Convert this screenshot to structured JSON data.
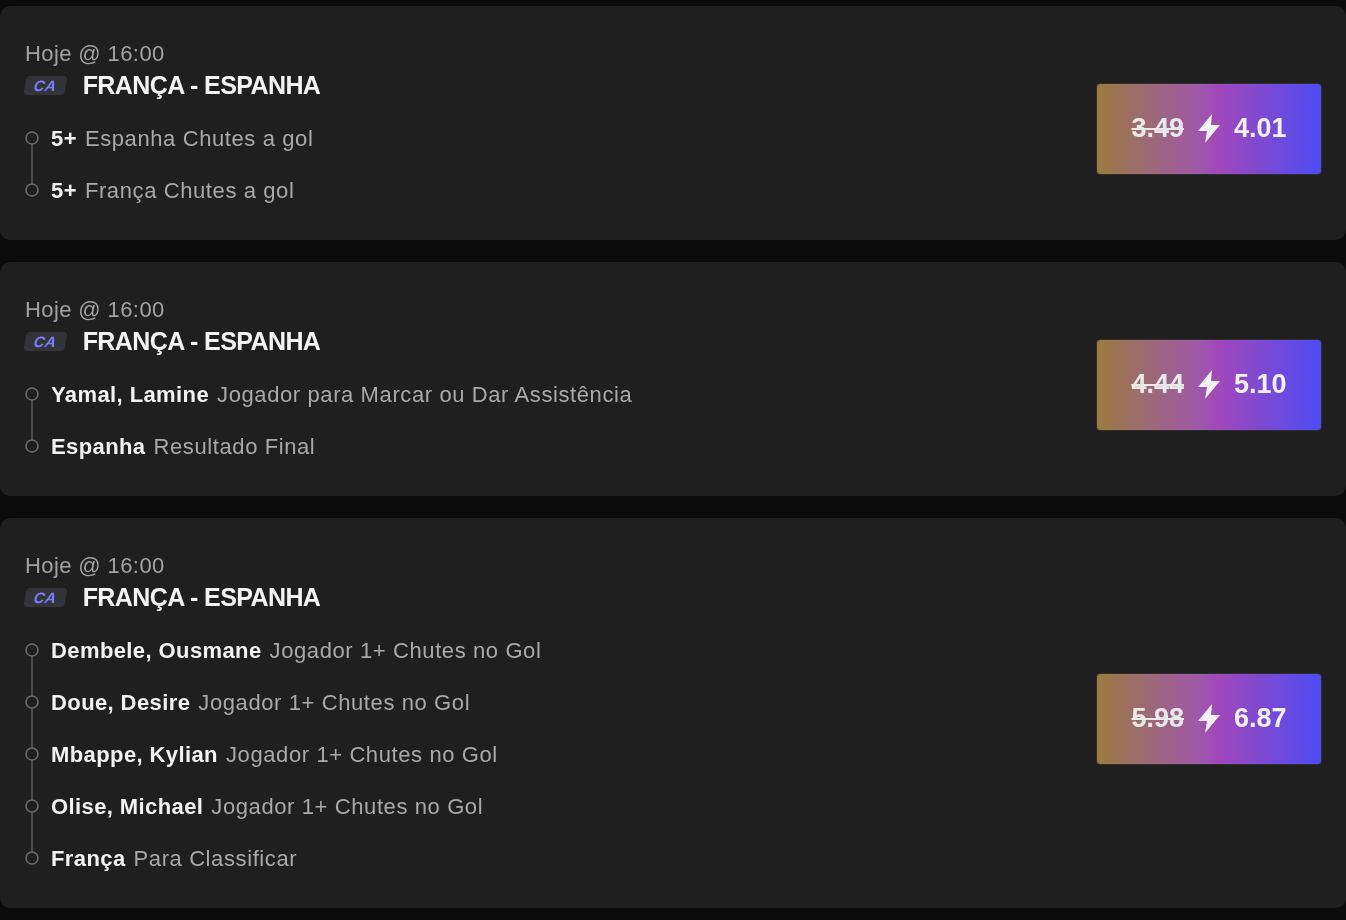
{
  "bets": [
    {
      "time": "Hoje @ 16:00",
      "badge": "CA",
      "match": "FRANÇA - ESPANHA",
      "selections": [
        {
          "name": "5+",
          "market": "Espanha Chutes a gol"
        },
        {
          "name": "5+",
          "market": "França Chutes a gol"
        }
      ],
      "old_odds": "3.49",
      "new_odds": "4.01"
    },
    {
      "time": "Hoje @ 16:00",
      "badge": "CA",
      "match": "FRANÇA - ESPANHA",
      "selections": [
        {
          "name": "Yamal, Lamine",
          "market": "Jogador para Marcar ou Dar Assistência"
        },
        {
          "name": "Espanha",
          "market": "Resultado Final"
        }
      ],
      "old_odds": "4.44",
      "new_odds": "5.10"
    },
    {
      "time": "Hoje @ 16:00",
      "badge": "CA",
      "match": "FRANÇA - ESPANHA",
      "selections": [
        {
          "name": "Dembele, Ousmane",
          "market": "Jogador 1+ Chutes no Gol"
        },
        {
          "name": "Doue, Desire",
          "market": "Jogador 1+ Chutes no Gol"
        },
        {
          "name": "Mbappe, Kylian",
          "market": "Jogador 1+ Chutes no Gol"
        },
        {
          "name": "Olise, Michael",
          "market": "Jogador 1+ Chutes no Gol"
        },
        {
          "name": "França",
          "market": "Para Classificar"
        }
      ],
      "old_odds": "5.98",
      "new_odds": "6.87"
    }
  ]
}
